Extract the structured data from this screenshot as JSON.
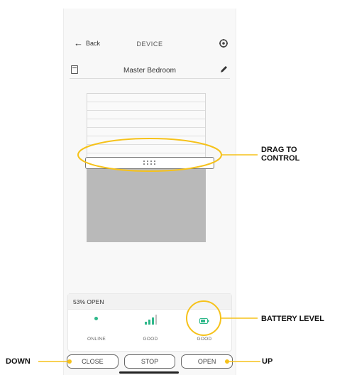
{
  "header": {
    "back_label": "Back",
    "title": "DEVICE"
  },
  "device": {
    "name": "Master Bedroom",
    "open_percent": 53
  },
  "status": {
    "position_text": "53% OPEN",
    "items": [
      {
        "label": "ONLINE",
        "icon": "online-dot-icon"
      },
      {
        "label": "GOOD",
        "icon": "signal-bars-icon"
      },
      {
        "label": "GOOD",
        "icon": "battery-icon"
      }
    ]
  },
  "controls": {
    "close_label": "CLOSE",
    "stop_label": "STOP",
    "open_label": "OPEN"
  },
  "callouts": {
    "drag_line1": "DRAG TO",
    "drag_line2": "CONTROL",
    "battery": "BATTERY LEVEL",
    "down": "DOWN",
    "up": "UP"
  },
  "colors": {
    "accent_yellow": "#F6C21A",
    "online_green": "#2EB88A",
    "shade_gray": "#B9B9B9"
  }
}
